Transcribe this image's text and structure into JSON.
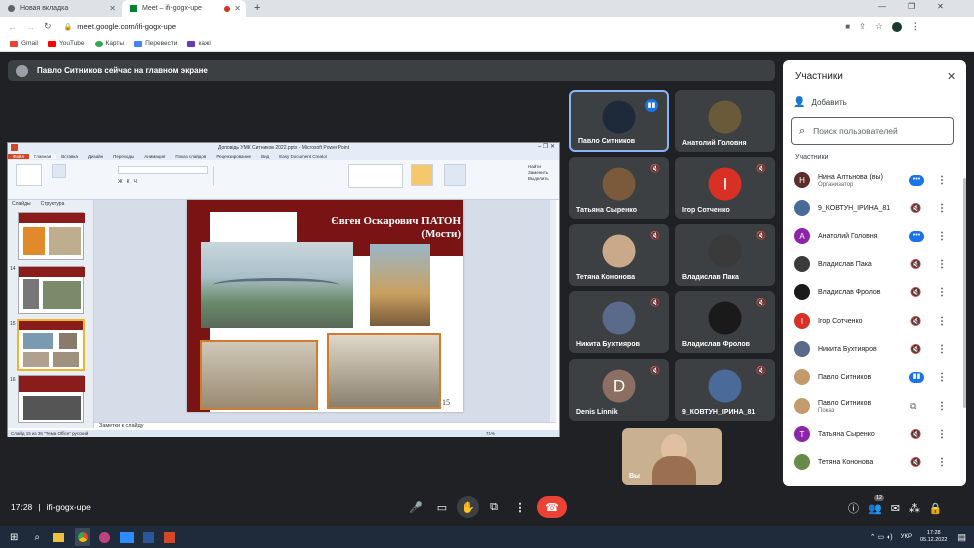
{
  "browser": {
    "tabs": [
      {
        "title": "Новая вкладка"
      },
      {
        "title": "Meet – ifi-gogx-upe"
      }
    ],
    "url": "meet.google.com/ifi-gogx-upe",
    "bookmarks": [
      "Gmail",
      "YouTube",
      "Карты",
      "Перевести",
      "кажі"
    ]
  },
  "banner": {
    "text": "Павло Ситников сейчас на главном экране"
  },
  "presentation": {
    "window_title": "Доповідь УМК Ситников 2022.pptx - Microsoft PowerPoint",
    "ribbon_tabs": [
      "Файл",
      "Главная",
      "Вставка",
      "Дизайн",
      "Переходы",
      "Анимация",
      "Показ слайдов",
      "Рецензирование",
      "Вид",
      "Easy Document Creator"
    ],
    "pane_tabs": [
      "Слайды",
      "Структура"
    ],
    "thumb_numbers": [
      "14",
      "15",
      "16"
    ],
    "slide_title": "Євген Оскарович ПАТОН (Мости)",
    "slide_number": "15",
    "notes": "Заметки к слайду",
    "status": "Слайд 15 из 36   \"Тема Office\"   русский",
    "zoom": "71%"
  },
  "tiles": [
    {
      "name": "Павло Ситников",
      "initial": "",
      "color": "#1e2a3a",
      "speaking": true,
      "muted": false
    },
    {
      "name": "Анатолий Головня",
      "initial": "",
      "color": "#6b5a3a",
      "speaking": false,
      "muted": false
    },
    {
      "name": "Татьяна Сыренко",
      "initial": "",
      "color": "#7a5a3a",
      "speaking": false,
      "muted": true
    },
    {
      "name": "Ігор Сотченко",
      "initial": "I",
      "color": "#d93025",
      "speaking": false,
      "muted": true
    },
    {
      "name": "Тетяна Кононова",
      "initial": "",
      "color": "#c9a98a",
      "speaking": false,
      "muted": true
    },
    {
      "name": "Владислав Пака",
      "initial": "",
      "color": "#3a3a3a",
      "speaking": false,
      "muted": true
    },
    {
      "name": "Никита Бухтияров",
      "initial": "",
      "color": "#5a6a8a",
      "speaking": false,
      "muted": true
    },
    {
      "name": "Владислав Фролов",
      "initial": "",
      "color": "#1a1a1a",
      "speaking": false,
      "muted": true
    },
    {
      "name": "Denis Linnik",
      "initial": "D",
      "color": "#8d6e63",
      "speaking": false,
      "muted": true
    },
    {
      "name": "9_КОВТУН_ІРИНА_81",
      "initial": "",
      "color": "#4a6a9a",
      "speaking": false,
      "muted": true
    }
  ],
  "self_tile": {
    "name": "Вы"
  },
  "participants_panel": {
    "title": "Участники",
    "add_label": "Добавить",
    "search_placeholder": "Поиск пользователей",
    "section_label": "Участники",
    "people": [
      {
        "name": "Нина Алтьнова (вы)",
        "sub": "Организатор",
        "initial": "Н",
        "color": "#5f2c2c",
        "state": "speaking"
      },
      {
        "name": "9_КОВТУН_ІРИНА_81",
        "sub": "",
        "initial": "",
        "color": "#4a6a9a",
        "state": "muted"
      },
      {
        "name": "Анатолий Головня",
        "sub": "",
        "initial": "А",
        "color": "#8e24aa",
        "state": "speaking"
      },
      {
        "name": "Владислав Пака",
        "sub": "",
        "initial": "",
        "color": "#3a3a3a",
        "state": "muted"
      },
      {
        "name": "Владислав Фролов",
        "sub": "",
        "initial": "",
        "color": "#1a1a1a",
        "state": "muted"
      },
      {
        "name": "Ігор Сотченко",
        "sub": "",
        "initial": "I",
        "color": "#d93025",
        "state": "muted"
      },
      {
        "name": "Никита Бухтияров",
        "sub": "",
        "initial": "",
        "color": "#5a6a8a",
        "state": "muted"
      },
      {
        "name": "Павло Ситников",
        "sub": "",
        "initial": "",
        "color": "#c49a6c",
        "state": "active"
      },
      {
        "name": "Павло Ситников",
        "sub": "Показ",
        "initial": "",
        "color": "#c49a6c",
        "state": "present"
      },
      {
        "name": "Татьяна Сыренко",
        "sub": "",
        "initial": "Т",
        "color": "#8e24aa",
        "state": "muted"
      },
      {
        "name": "Тетяна Кононова",
        "sub": "",
        "initial": "",
        "color": "#6a8a4a",
        "state": "muted"
      }
    ]
  },
  "bottom": {
    "time": "17:28",
    "meeting_code": "ifi-gogx-upe",
    "people_count": "12"
  },
  "taskbar": {
    "lang": "УКР",
    "clock_time": "17:28",
    "clock_date": "05.12.2022"
  }
}
